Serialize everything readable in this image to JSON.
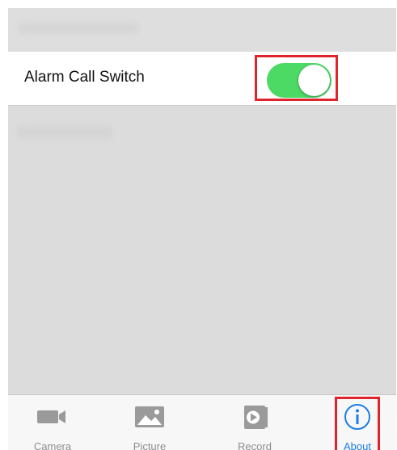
{
  "settings": {
    "alarm_call_switch": {
      "label": "Alarm Call Switch",
      "state": "on"
    }
  },
  "tabbar": {
    "tabs": [
      {
        "label": "Camera",
        "icon": "camera-icon"
      },
      {
        "label": "Picture",
        "icon": "picture-icon"
      },
      {
        "label": "Record",
        "icon": "record-icon"
      },
      {
        "label": "About",
        "icon": "info-icon",
        "active": true
      }
    ]
  },
  "colors": {
    "toggle_on": "#4cd964",
    "active_tab": "#1a7ee6",
    "inactive_tab": "#8e8e93",
    "highlight_box": "#e0242b",
    "background": "#dcdcdc"
  }
}
